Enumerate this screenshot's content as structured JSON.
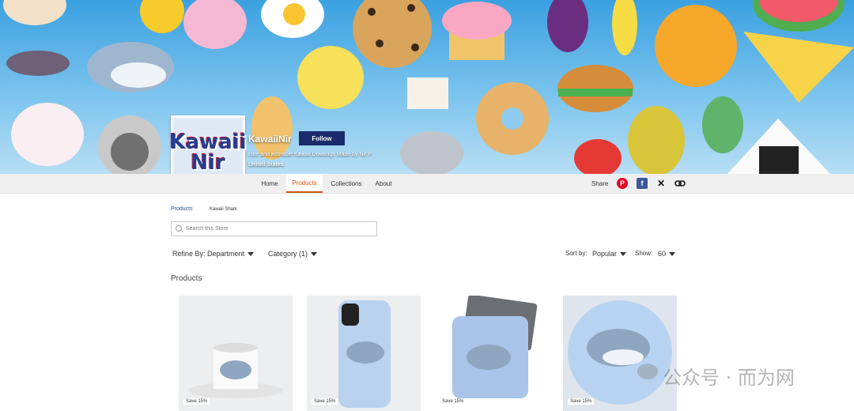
{
  "store": {
    "logo_line1": "Kawaii",
    "logo_line2": "Nir",
    "name": "KawaiiNir",
    "follow_label": "Follow",
    "tagline": "cute and adorable Kawaii Drawings Made by Nir P",
    "country": "United States"
  },
  "nav": {
    "tabs": [
      {
        "label": "Home"
      },
      {
        "label": "Products"
      },
      {
        "label": "Collections"
      },
      {
        "label": "About"
      }
    ],
    "active_tab": "Products",
    "share_label": "Share",
    "share_icons": [
      "pinterest-icon",
      "facebook-icon",
      "x-icon",
      "link-icon"
    ]
  },
  "breadcrumb": {
    "root": "Products",
    "current": "Kawaii Shark"
  },
  "search": {
    "placeholder": "Search this Store"
  },
  "filters": {
    "refine": "Refine By: Department",
    "category": "Category (1)",
    "sort_label": "Sort by:",
    "sort_value": "Popular",
    "show_label": "Show:",
    "show_value": "60"
  },
  "section_title": "Products",
  "products": [
    {
      "badge": "Save 15%",
      "kind": "mug"
    },
    {
      "badge": "Save 15%",
      "kind": "phone-case"
    },
    {
      "badge": "Save 15%",
      "kind": "laptop-sleeve"
    },
    {
      "badge": "Save 15%",
      "kind": "round-sticker"
    }
  ],
  "watermark": "公众号 · 而为网",
  "colors": {
    "accent": "#d0541c",
    "follow_button": "#1b2a6b",
    "banner": "#3aa0e0"
  }
}
